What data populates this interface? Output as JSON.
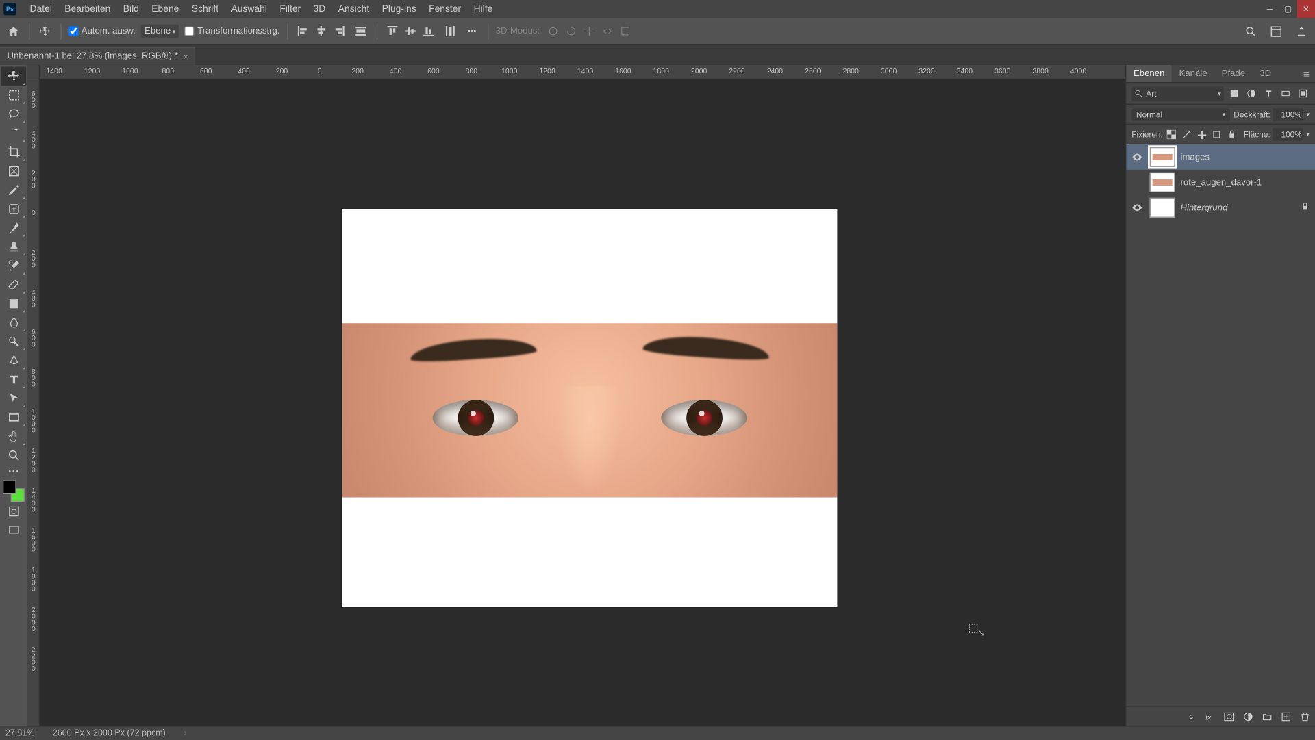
{
  "menu": [
    "Datei",
    "Bearbeiten",
    "Bild",
    "Ebene",
    "Schrift",
    "Auswahl",
    "Filter",
    "3D",
    "Ansicht",
    "Plug-ins",
    "Fenster",
    "Hilfe"
  ],
  "options": {
    "auto_select": "Autom. ausw.",
    "auto_select_target": "Ebene",
    "transform_ctrl": "Transformationsstrg.",
    "mode3d_label": "3D-Modus:"
  },
  "doc_tab": {
    "title": "Unbenannt-1 bei 27,8% (images, RGB/8) *"
  },
  "hruler_ticks": [
    "1400",
    "1200",
    "1000",
    "800",
    "600",
    "400",
    "200",
    "0",
    "200",
    "400",
    "600",
    "800",
    "1000",
    "1200",
    "1400",
    "1600",
    "1800",
    "2000",
    "2200",
    "2400",
    "2600",
    "2800",
    "3000",
    "3200",
    "3400",
    "3600",
    "3800",
    "4000"
  ],
  "vruler_ticks": [
    "600",
    "400",
    "200",
    "0",
    "200",
    "400",
    "600",
    "800",
    "1000",
    "1200",
    "1400",
    "1600",
    "1800",
    "2000",
    "2200"
  ],
  "panel": {
    "tabs": [
      "Ebenen",
      "Kanäle",
      "Pfade",
      "3D"
    ],
    "filter_kind": "Art",
    "blend_mode": "Normal",
    "opacity_label": "Deckkraft:",
    "opacity_value": "100%",
    "lock_label": "Fixieren:",
    "fill_label": "Fläche:",
    "fill_value": "100%"
  },
  "layers": [
    {
      "name": "images",
      "visible": true,
      "thumb": "face",
      "selected": true,
      "locked": false,
      "italic": false
    },
    {
      "name": "rote_augen_davor-1",
      "visible": false,
      "thumb": "face",
      "selected": false,
      "locked": false,
      "italic": false
    },
    {
      "name": "Hintergrund",
      "visible": true,
      "thumb": "white",
      "selected": false,
      "locked": true,
      "italic": true
    }
  ],
  "status": {
    "zoom": "27,81%",
    "dims": "2600 Px x 2000 Px (72 ppcm)"
  }
}
